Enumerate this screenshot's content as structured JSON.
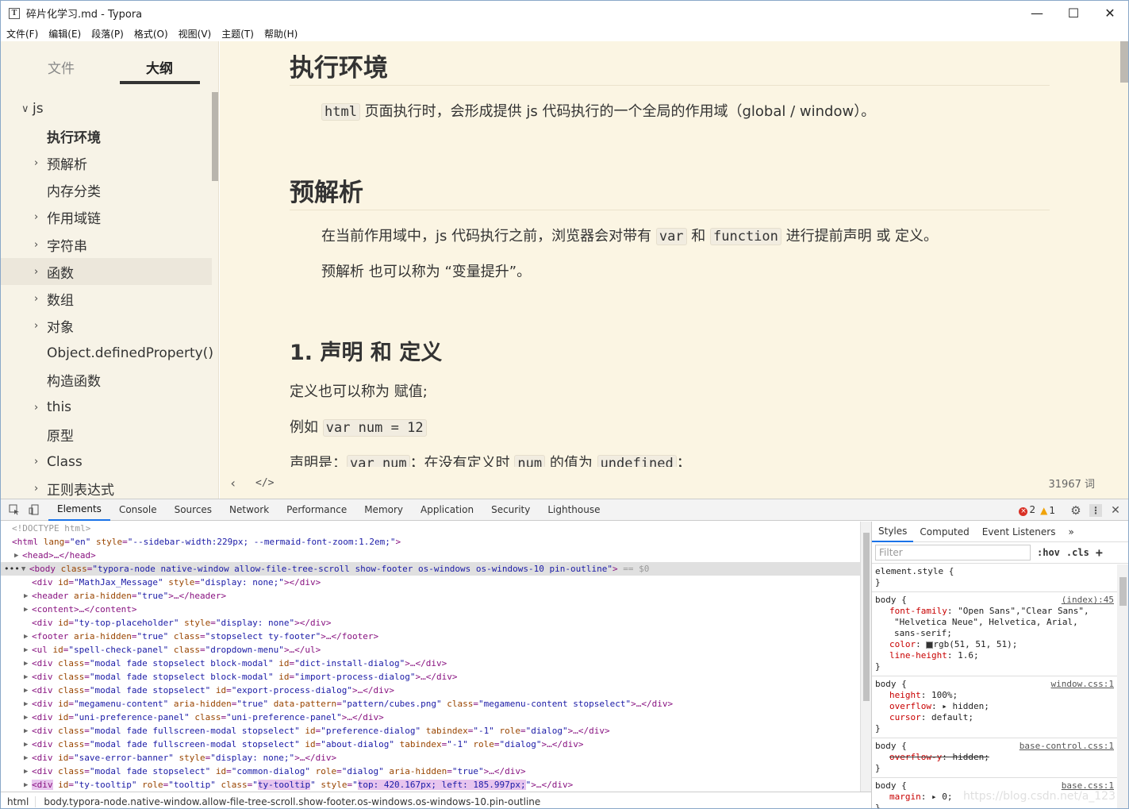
{
  "window": {
    "title": "碎片化学习.md - Typora",
    "app_icon": "T",
    "minimize": "—",
    "maximize": "☐",
    "close": "✕"
  },
  "menu": [
    "文件(F)",
    "编辑(E)",
    "段落(P)",
    "格式(O)",
    "视图(V)",
    "主题(T)",
    "帮助(H)"
  ],
  "sidebar": {
    "tab_files": "文件",
    "tab_outline": "大纲",
    "active_tab": "大纲",
    "items": [
      {
        "label": "js",
        "chevron": "∨",
        "level": 0
      },
      {
        "label": "执行环境",
        "chevron": "",
        "level": 1,
        "bold": true
      },
      {
        "label": "预解析",
        "chevron": "›",
        "level": 1
      },
      {
        "label": "内存分类",
        "chevron": "",
        "level": 1
      },
      {
        "label": "作用域链",
        "chevron": "›",
        "level": 1
      },
      {
        "label": "字符串",
        "chevron": "›",
        "level": 1
      },
      {
        "label": "函数",
        "chevron": "›",
        "level": 1,
        "selected": true
      },
      {
        "label": "数组",
        "chevron": "›",
        "level": 1
      },
      {
        "label": "对象",
        "chevron": "›",
        "level": 1
      },
      {
        "label": "Object.definedProperty()",
        "chevron": "",
        "level": 1
      },
      {
        "label": "构造函数",
        "chevron": "",
        "level": 1
      },
      {
        "label": "this",
        "chevron": "›",
        "level": 1
      },
      {
        "label": "原型",
        "chevron": "",
        "level": 1
      },
      {
        "label": "Class",
        "chevron": "›",
        "level": 1
      },
      {
        "label": "正则表达式",
        "chevron": "›",
        "level": 1
      }
    ]
  },
  "editor": {
    "h_exec": "执行环境",
    "p_exec_code": "html",
    "p_exec_text": " 页面执行时，会形成提供 js 代码执行的一个全局的作用域（global / window）。",
    "h_preparse": "预解析",
    "p_pre_1a": "在当前作用域中，js 代码执行之前，浏览器会对带有 ",
    "p_pre_code1": "var",
    "p_pre_1b": " 和 ",
    "p_pre_code2": "function",
    "p_pre_1c": " 进行提前声明 或 定义。",
    "p_pre_2": "预解析 也可以称为 “变量提升”。",
    "h_decl": "1. 声明 和 定义",
    "p_decl_1": "定义也可以称为 赋值;",
    "p_decl_2a": "例如 ",
    "p_decl_code": "var num = 12",
    "p_decl_3a": "声明是：",
    "p_decl_3_code1": "var num",
    "p_decl_3b": "；在没有定义时 ",
    "p_decl_3_code2": "num",
    "p_decl_3c": " 的值为 ",
    "p_decl_3_code3": "undefined",
    "p_decl_3d": "；",
    "footer_back": "‹",
    "footer_source": "</>",
    "word_count": "31967 词"
  },
  "devtools": {
    "tabs": [
      "Elements",
      "Console",
      "Sources",
      "Network",
      "Performance",
      "Memory",
      "Application",
      "Security",
      "Lighthouse"
    ],
    "active_tab": "Elements",
    "errors": "2",
    "warnings": "1",
    "more_tabs": "»",
    "styles_tabs": [
      "Styles",
      "Computed",
      "Event Listeners"
    ],
    "filter_placeholder": "Filter",
    "hov": ":hov",
    "cls": ".cls",
    "plus": "+",
    "breadcrumb_html": "html",
    "breadcrumb_body": "body.typora-node.native-window.allow-file-tree-scroll.show-footer.os-windows.os-windows-10.pin-outline",
    "element_style": "element.style {",
    "element_style_close": "}",
    "rules": [
      {
        "selector": "body {",
        "source": "(index):45",
        "props": [
          {
            "name": "font-family",
            "value": "\"Open Sans\",\"Clear Sans\","
          },
          {
            "name": "",
            "value": "  \"Helvetica Neue\", Helvetica, Arial,"
          },
          {
            "name": "",
            "value": "  sans-serif;"
          },
          {
            "name": "color",
            "value": "rgb(51, 51, 51);",
            "swatch": true
          },
          {
            "name": "line-height",
            "value": "1.6;"
          }
        ]
      },
      {
        "selector": "body {",
        "source": "window.css:1",
        "props": [
          {
            "name": "height",
            "value": "100%;"
          },
          {
            "name": "overflow",
            "value": "▸ hidden;"
          },
          {
            "name": "cursor",
            "value": "default;"
          }
        ]
      },
      {
        "selector": "body {",
        "source": "base-control.css:1",
        "props": [
          {
            "name": "overflow-y",
            "value": "hidden;",
            "strike": true
          }
        ]
      },
      {
        "selector": "body {",
        "source": "base.css:1",
        "props": [
          {
            "name": "margin",
            "value": "▸ 0;"
          }
        ]
      }
    ],
    "watermark": "https://blog.csdn.net/a_123"
  }
}
